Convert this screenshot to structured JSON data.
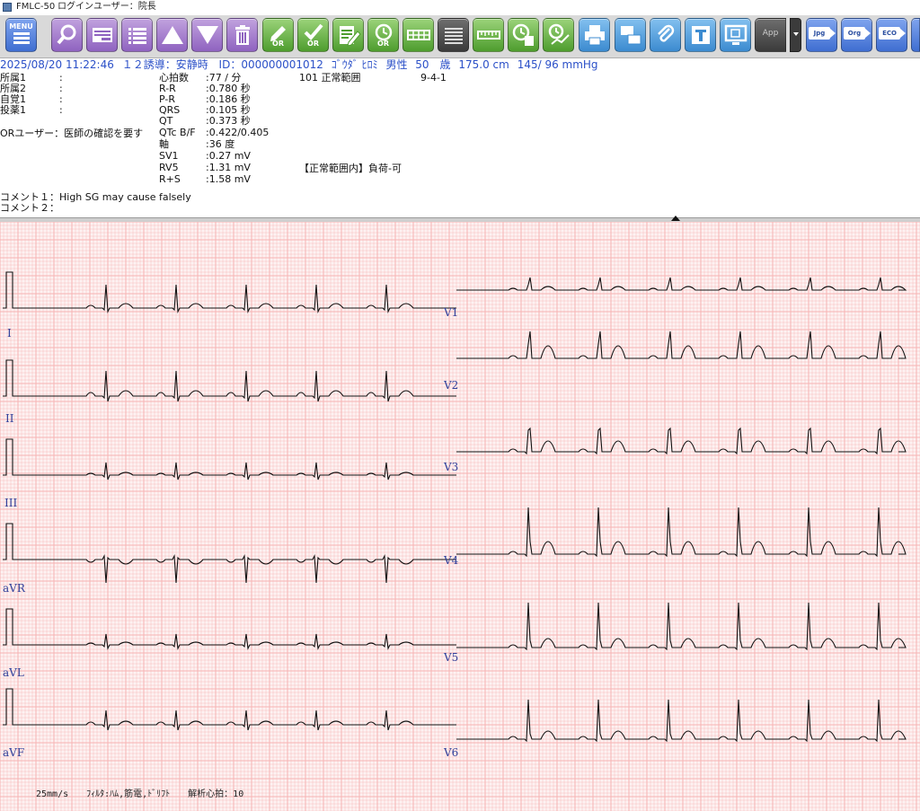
{
  "titlebar": {
    "app_name": "FMLC-50",
    "login_user": "ログインユーザー：院長"
  },
  "toolbar": {
    "menu_label": "MENU",
    "or_label": "OR",
    "app_label": "App",
    "jpg_label": "Jpg",
    "org_label": "Org",
    "eco_label": "ECO",
    "buttons": [
      {
        "name": "menu-button",
        "color": "#3f6ed1",
        "icon": "menu-icon"
      },
      {
        "name": "search-button",
        "color": "#8f63c0",
        "icon": "magnifier-icon"
      },
      {
        "name": "record-list-button",
        "color": "#8f63c0",
        "icon": "record-card-icon"
      },
      {
        "name": "list-view-button",
        "color": "#8f63c0",
        "icon": "list-icon"
      },
      {
        "name": "previous-record-button",
        "color": "#8f63c0",
        "icon": "arrow-up-icon"
      },
      {
        "name": "next-record-button",
        "color": "#8f63c0",
        "icon": "arrow-down-icon"
      },
      {
        "name": "delete-button",
        "color": "#8f63c0",
        "icon": "trash-icon"
      },
      {
        "name": "or-edit-button",
        "color": "#4e9d2e",
        "icon": "pen-or-icon"
      },
      {
        "name": "or-confirm-button",
        "color": "#4e9d2e",
        "icon": "check-or-icon"
      },
      {
        "name": "report-edit-button",
        "color": "#4e9d2e",
        "icon": "document-pen-icon"
      },
      {
        "name": "or-timer-button",
        "color": "#4e9d2e",
        "icon": "clock-or-icon"
      },
      {
        "name": "layout-button",
        "color": "#4e9d2e",
        "icon": "grid-icon"
      },
      {
        "name": "lead-list-button",
        "color": "#3b3b3b",
        "icon": "lines-icon"
      },
      {
        "name": "ruler-button",
        "color": "#4e9d2e",
        "icon": "ruler-icon"
      },
      {
        "name": "timer-document-button",
        "color": "#4e9d2e",
        "icon": "clock-document-icon"
      },
      {
        "name": "timer-chart-button",
        "color": "#4e9d2e",
        "icon": "clock-chart-icon"
      },
      {
        "name": "print-button",
        "color": "#3c8bd0",
        "icon": "printer-icon"
      },
      {
        "name": "print-transfer-button",
        "color": "#3c8bd0",
        "icon": "transfer-printer-icon"
      },
      {
        "name": "attach-button",
        "color": "#3c8bd0",
        "icon": "paperclip-icon"
      },
      {
        "name": "text-button",
        "color": "#3c8bd0",
        "icon": "text-t-icon"
      },
      {
        "name": "monitor-button",
        "color": "#3c8bd0",
        "icon": "monitor-icon"
      },
      {
        "name": "app-button",
        "color": "#3b3b3b",
        "icon": "app-icon"
      },
      {
        "name": "export-jpg-button",
        "color": "#3f6ed1",
        "icon": "jpg-arrow-icon"
      },
      {
        "name": "export-org-button",
        "color": "#3f6ed1",
        "icon": "org-arrow-icon"
      },
      {
        "name": "export-eco-button",
        "color": "#3f6ed1",
        "icon": "eco-arrow-icon"
      }
    ]
  },
  "patient": {
    "datetime": "2025/08/20 11:22:46",
    "lead_mode": "１２誘導：安静時",
    "id_label": "ID：",
    "id_value": "000000001012",
    "name": "ｺﾞｳﾀﾞ ﾋﾛﾐ",
    "sex": "男性",
    "age": "50　歳",
    "height": "175.0 cm",
    "bp": "145/ 96 mmHg"
  },
  "info": {
    "affiliation1": "所属1",
    "affiliation2": "所属2",
    "symptom1": "自覚1",
    "medication1": "投薬1",
    "colon": ":",
    "or_user": "ORユーザー：医師の確認を要す",
    "comment1": "コメント１：High SG may cause falsely",
    "comment2": "コメント２："
  },
  "measurements": [
    {
      "label": "心拍数",
      "value": ":77 / 分"
    },
    {
      "label": "R-R",
      "value": ":0.780 秒"
    },
    {
      "label": "P-R",
      "value": ":0.186 秒"
    },
    {
      "label": "QRS",
      "value": ":0.105 秒"
    },
    {
      "label": "QT",
      "value": ":0.373 秒"
    },
    {
      "label": "QTc B/F",
      "value": ":0.422/0.405"
    },
    {
      "label": "軸",
      "value": ":36 度"
    },
    {
      "label": "SV1",
      "value": ":0.27 mV"
    },
    {
      "label": "RV5",
      "value": ":1.31 mV"
    },
    {
      "label": "R+S",
      "value": ":1.58 mV"
    }
  ],
  "diagnosis": {
    "code": "101 正常範囲",
    "minnesota": "9-4-1",
    "summary": "【正常範囲内】負荷-可"
  },
  "ecg": {
    "left_leads": [
      "I",
      "II",
      "III",
      "aVR",
      "aVL",
      "aVF"
    ],
    "right_leads": [
      "V1",
      "V2",
      "V3",
      "V4",
      "V5",
      "V6"
    ],
    "grid_color": "#f6b3b3",
    "trace_color": "#111111",
    "footer": "25mm/s　　ﾌｨﾙﾀ:ﾊﾑ,筋電,ﾄﾞﾘﾌﾄ　　解析心拍：10"
  }
}
